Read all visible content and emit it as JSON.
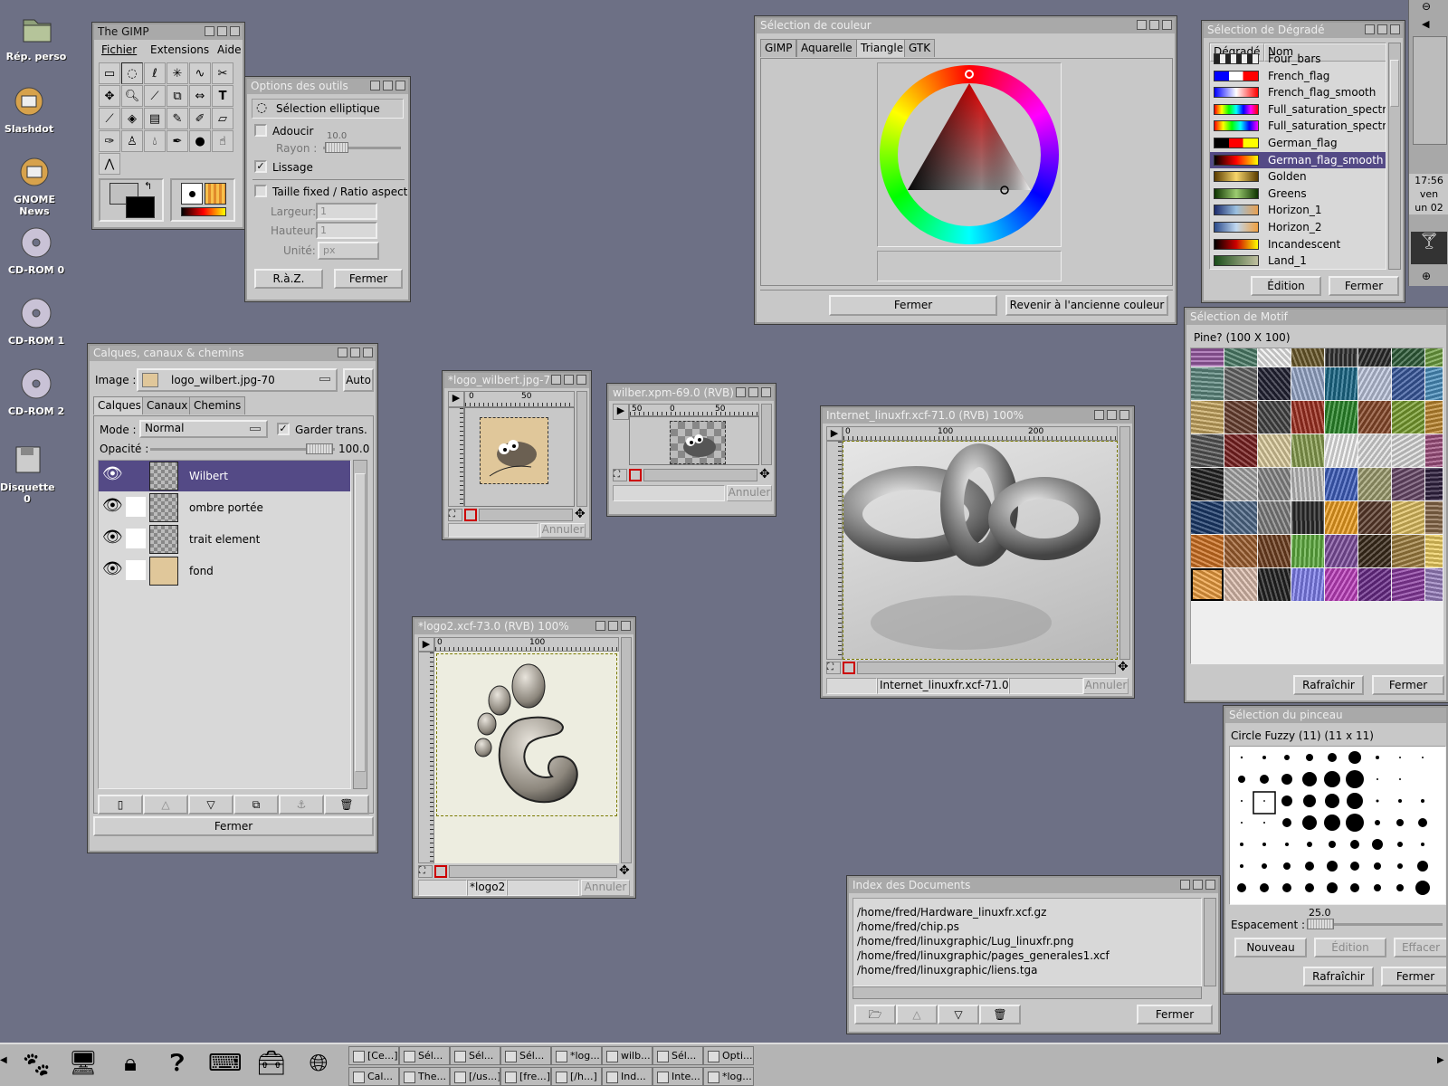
{
  "desktop": {
    "icons": [
      {
        "label": "Rép. perso"
      },
      {
        "label": "Slashdot"
      },
      {
        "label": "GNOME News"
      },
      {
        "label": "CD-ROM 0"
      },
      {
        "label": "CD-ROM 1"
      },
      {
        "label": "CD-ROM 2"
      },
      {
        "label": "Disquette 0"
      }
    ],
    "clock": {
      "time": "17:56",
      "day": "ven",
      "date": "un 02"
    }
  },
  "toolbox": {
    "title": "The GIMP",
    "menu": [
      "Fichier",
      "Extensions",
      "Aide"
    ]
  },
  "tool_options": {
    "title": "Options des outils",
    "tool_name": "Sélection elliptique",
    "feather_label": "Adoucir",
    "radius_label": "Rayon :",
    "radius_value": "10.0",
    "antialias_label": "Lissage",
    "fixed_label": "Taille fixed / Ratio aspect",
    "width_label": "Largeur:",
    "width_value": "1",
    "height_label": "Hauteur:",
    "height_value": "1",
    "unit_label": "Unité:",
    "unit_value": "px",
    "reset_button": "R.à.Z.",
    "close_button": "Fermer"
  },
  "color_selector": {
    "title": "Sélection de couleur",
    "tabs": [
      "GIMP",
      "Aquarelle",
      "Triangle",
      "GTK"
    ],
    "active_tab": "Triangle",
    "close_button": "Fermer",
    "revert_button": "Revenir à l'ancienne couleur"
  },
  "gradient_selector": {
    "title": "Sélection de Dégradé",
    "col_gradient": "Dégradé",
    "col_name": "Nom",
    "items": [
      {
        "name": "Four_bars"
      },
      {
        "name": "French_flag"
      },
      {
        "name": "French_flag_smooth"
      },
      {
        "name": "Full_saturation_spectru"
      },
      {
        "name": "Full_saturation_spectru"
      },
      {
        "name": "German_flag"
      },
      {
        "name": "German_flag_smooth"
      },
      {
        "name": "Golden"
      },
      {
        "name": "Greens"
      },
      {
        "name": "Horizon_1"
      },
      {
        "name": "Horizon_2"
      },
      {
        "name": "Incandescent"
      },
      {
        "name": "Land_1"
      }
    ],
    "selected": "German_flag_smooth",
    "edit_button": "Édition",
    "close_button": "Fermer"
  },
  "layers": {
    "title": "Calques, canaux & chemins",
    "image_label": "Image :",
    "image_value": "logo_wilbert.jpg-70",
    "auto_button": "Auto",
    "tabs": [
      "Calques",
      "Canaux",
      "Chemins"
    ],
    "mode_label": "Mode :",
    "mode_value": "Normal",
    "keep_trans_label": "Garder trans.",
    "opacity_label": "Opacité :",
    "opacity_value": "100.0",
    "items": [
      {
        "name": "Wilbert"
      },
      {
        "name": "ombre portée"
      },
      {
        "name": "trait element"
      },
      {
        "name": "fond"
      }
    ],
    "close_button": "Fermer"
  },
  "img_wilbert": {
    "title": "*logo_wilbert.jpg-7",
    "ruler_labels": [
      "0",
      "50"
    ],
    "cancel": "Annuler"
  },
  "img_wilber_xpm": {
    "title": "wilber.xpm-69.0 (RVB)",
    "ruler_labels": [
      "50",
      "0",
      "50"
    ],
    "cancel": "Annuler"
  },
  "img_linuxfr": {
    "title": "Internet_linuxfr.xcf-71.0 (RVB) 100%",
    "ruler_labels": [
      "0",
      "100",
      "200"
    ],
    "status": "Internet_linuxfr.xcf-71.0 (",
    "cancel": "Annuler"
  },
  "img_logo2": {
    "title": "*logo2.xcf-73.0 (RVB) 100%",
    "ruler_labels": [
      "0",
      "100"
    ],
    "status": "*logo2.",
    "cancel": "Annuler"
  },
  "pattern_selector": {
    "title": "Sélection de Motif",
    "info": "Pine?  (100 X 100)",
    "refresh_button": "Rafraîchir",
    "close_button": "Fermer"
  },
  "brush_selector": {
    "title": "Sélection du pinceau",
    "info": "Circle Fuzzy (11)  (11 x 11)",
    "spacing_label": "Espacement :",
    "spacing_value": "25.0",
    "new_button": "Nouveau",
    "edit_button": "Édition",
    "delete_button": "Effacer",
    "refresh_button": "Rafraîchir",
    "close_button": "Fermer"
  },
  "doc_index": {
    "title": "Index des Documents",
    "items": [
      "/home/fred/Hardware_linuxfr.xcf.gz",
      "/home/fred/chip.ps",
      "/home/fred/linuxgraphic/Lug_linuxfr.png",
      "/home/fred/linuxgraphic/pages_generales1.xcf",
      "/home/fred/linuxgraphic/liens.tga"
    ],
    "close_button": "Fermer"
  },
  "taskbar": {
    "row1": [
      "[Ce...]",
      "Sél...",
      "Sél...",
      "Sél...",
      "*log...",
      "wilb...",
      "Sél...",
      "Opti..."
    ],
    "row2": [
      "Cal...",
      "The...",
      "[/us...]",
      "[fre...]",
      "[/h...]",
      "Ind...",
      "Inte...",
      "*log..."
    ]
  },
  "colors": {
    "desktop": "#6d7085",
    "selection": "#544a86",
    "window": "#c8c8c8"
  }
}
